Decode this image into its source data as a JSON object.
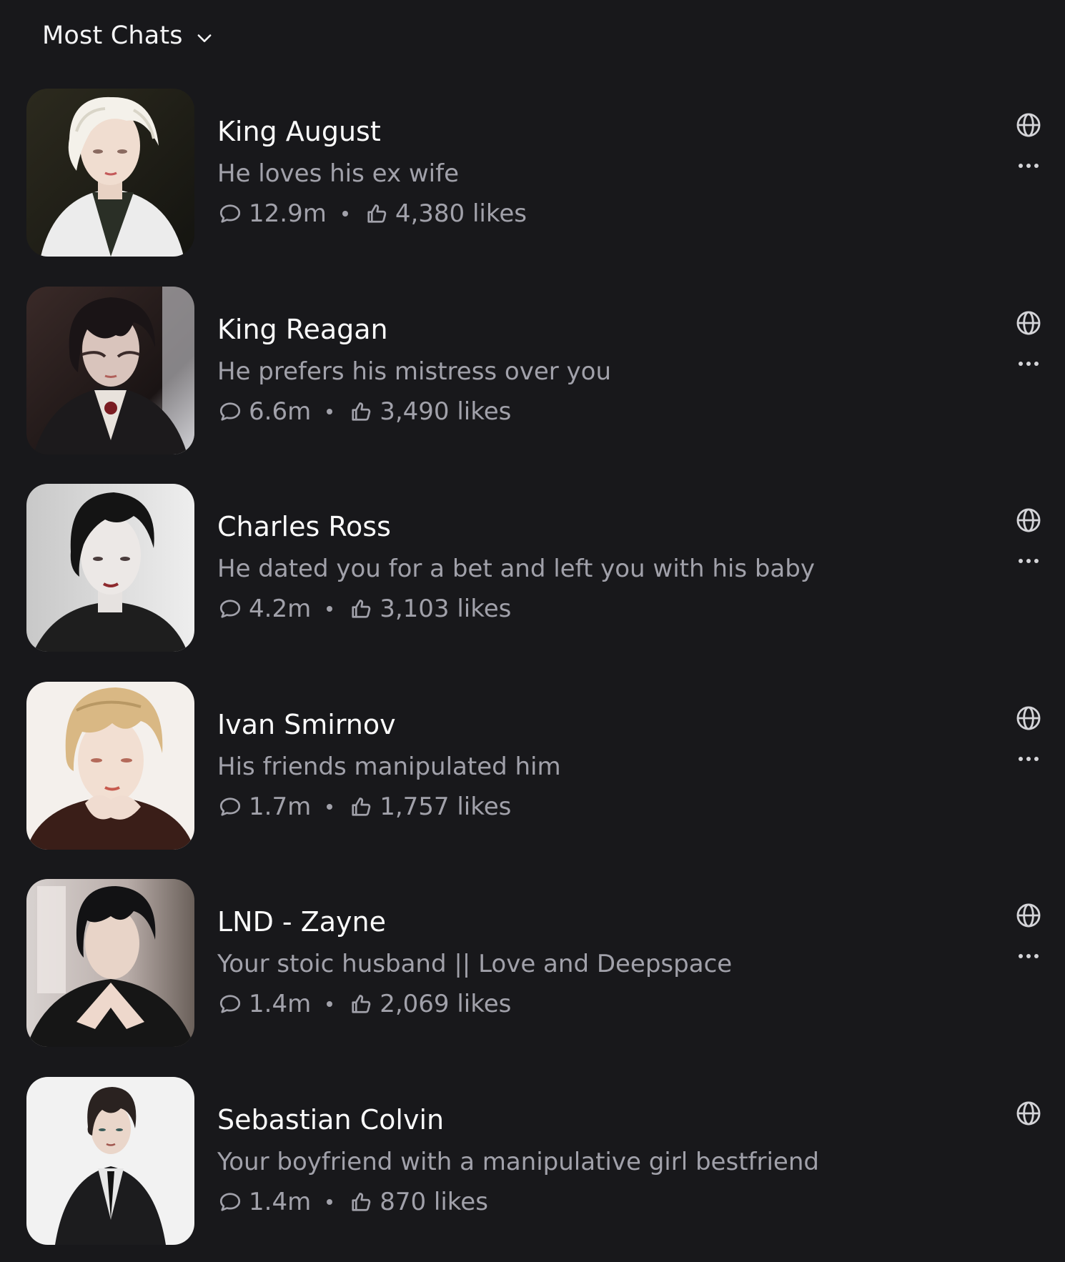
{
  "header": {
    "sort_label": "Most Chats"
  },
  "colors": {
    "background": "#18181b",
    "primary_text": "#fafafa",
    "secondary_text": "#a1a1aa"
  },
  "characters": [
    {
      "name": "King August",
      "description": "He loves his ex wife",
      "chats": "12.9m",
      "likes": "4,380 likes",
      "has_more_menu": true
    },
    {
      "name": "King Reagan",
      "description": "He prefers his mistress over you",
      "chats": "6.6m",
      "likes": "3,490 likes",
      "has_more_menu": true
    },
    {
      "name": "Charles Ross",
      "description": "He dated you for a bet and left you with his baby",
      "chats": "4.2m",
      "likes": "3,103 likes",
      "has_more_menu": true
    },
    {
      "name": "Ivan Smirnov",
      "description": "His friends manipulated him",
      "chats": "1.7m",
      "likes": "1,757 likes",
      "has_more_menu": true
    },
    {
      "name": "LND - Zayne",
      "description": "Your stoic husband || Love and Deepspace",
      "chats": "1.4m",
      "likes": "2,069 likes",
      "has_more_menu": true
    },
    {
      "name": "Sebastian Colvin",
      "description": "Your boyfriend with a manipulative girl bestfriend",
      "chats": "1.4m",
      "likes": "870 likes",
      "has_more_menu": false
    }
  ],
  "icons": {
    "sort": "chevron-down-icon",
    "chats": "chat-bubble-icon",
    "likes": "thumbs-up-icon",
    "visibility": "globe-icon",
    "menu": "more-dots-icon"
  }
}
